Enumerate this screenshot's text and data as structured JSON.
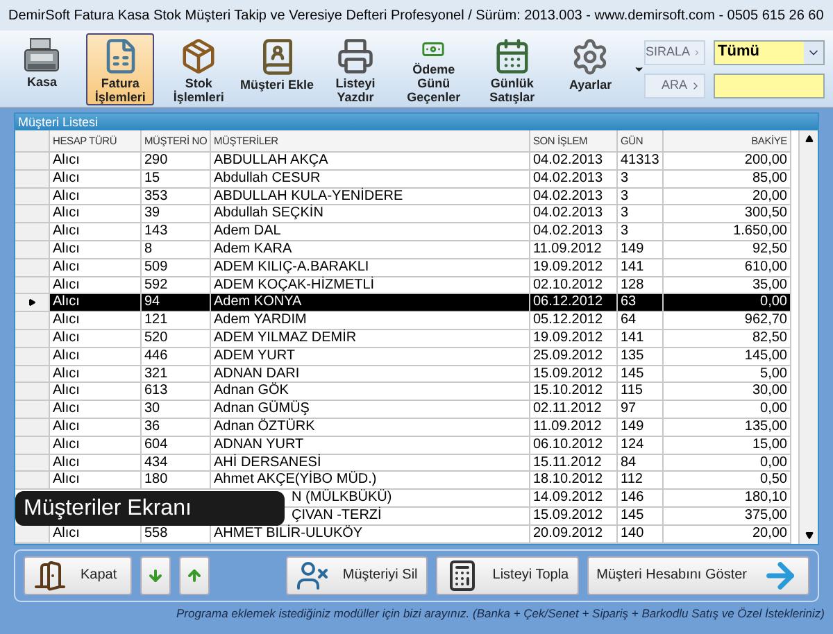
{
  "window": {
    "title": "DemirSoft Fatura Kasa Stok Müşteri Takip ve Veresiye Defteri Profesyonel  / Sürüm: 2013.003  -  www.demirsoft.com  -  0505 615 26 60"
  },
  "toolbar": {
    "items": [
      {
        "kind": "register",
        "label": "Kasa",
        "selected": false
      },
      {
        "kind": "invoice",
        "label": "Fatura İşlemleri",
        "selected": true
      },
      {
        "kind": "box",
        "label": "Stok İşlemleri",
        "selected": false
      },
      {
        "kind": "book",
        "label": "Müşteri Ekle",
        "selected": false
      },
      {
        "kind": "printer",
        "label": "Listeyi Yazdır",
        "selected": false
      },
      {
        "kind": "money",
        "label": "Ödeme Günü Geçenler",
        "selected": false
      },
      {
        "kind": "calendar",
        "label": "Günlük Satışlar",
        "selected": false
      },
      {
        "kind": "gear",
        "label": "Ayarlar",
        "selected": false
      }
    ]
  },
  "sort": {
    "label": "SIRALA",
    "value": "Tümü"
  },
  "search": {
    "label": "ARA"
  },
  "list": {
    "title": "Müşteri Listesi",
    "columns": [
      "HESAP TÜRÜ",
      "MÜŞTERİ NO",
      "MÜŞTERİLER",
      "SON İŞLEM",
      "GÜN",
      "BAKİYE"
    ],
    "rows": [
      {
        "type": "Alıcı",
        "no": "290",
        "name": "ABDULLAH AKÇA",
        "last": "04.02.2013",
        "days": "41313",
        "balance": "200,00",
        "selected": false
      },
      {
        "type": "Alıcı",
        "no": "15",
        "name": "Abdullah CESUR",
        "last": "04.02.2013",
        "days": "3",
        "balance": "85,00",
        "selected": false
      },
      {
        "type": "Alıcı",
        "no": "353",
        "name": "ABDULLAH KULA-YENİDERE",
        "last": "04.02.2013",
        "days": "3",
        "balance": "20,00",
        "selected": false
      },
      {
        "type": "Alıcı",
        "no": "39",
        "name": "Abdullah SEÇKİN",
        "last": "04.02.2013",
        "days": "3",
        "balance": "300,50",
        "selected": false
      },
      {
        "type": "Alıcı",
        "no": "143",
        "name": "Adem DAL",
        "last": "04.02.2013",
        "days": "3",
        "balance": "1.650,00",
        "selected": false
      },
      {
        "type": "Alıcı",
        "no": "8",
        "name": "Adem KARA",
        "last": "11.09.2012",
        "days": "149",
        "balance": "92,50",
        "selected": false
      },
      {
        "type": "Alıcı",
        "no": "509",
        "name": "ADEM KILIÇ-A.BARAKLI",
        "last": "19.09.2012",
        "days": "141",
        "balance": "610,00",
        "selected": false
      },
      {
        "type": "Alıcı",
        "no": "592",
        "name": "ADEM KOÇAK-HİZMETLİ",
        "last": "02.10.2012",
        "days": "128",
        "balance": "35,00",
        "selected": false
      },
      {
        "type": "Alıcı",
        "no": "94",
        "name": "Adem KONYA",
        "last": "06.12.2012",
        "days": "63",
        "balance": "0,00",
        "selected": true
      },
      {
        "type": "Alıcı",
        "no": "121",
        "name": "Adem YARDIM",
        "last": "05.12.2012",
        "days": "64",
        "balance": "962,70",
        "selected": false
      },
      {
        "type": "Alıcı",
        "no": "520",
        "name": "ADEM YILMAZ DEMİR",
        "last": "19.09.2012",
        "days": "141",
        "balance": "82,50",
        "selected": false
      },
      {
        "type": "Alıcı",
        "no": "446",
        "name": "ADEM YURT",
        "last": "25.09.2012",
        "days": "135",
        "balance": "145,00",
        "selected": false
      },
      {
        "type": "Alıcı",
        "no": "321",
        "name": "ADNAN DARI",
        "last": "15.09.2012",
        "days": "145",
        "balance": "5,00",
        "selected": false
      },
      {
        "type": "Alıcı",
        "no": "613",
        "name": "Adnan GÖK",
        "last": "15.10.2012",
        "days": "115",
        "balance": "30,00",
        "selected": false
      },
      {
        "type": "Alıcı",
        "no": "30",
        "name": "Adnan GÜMÜŞ",
        "last": "02.11.2012",
        "days": "97",
        "balance": "0,00",
        "selected": false
      },
      {
        "type": "Alıcı",
        "no": "36",
        "name": "Adnan ÖZTÜRK",
        "last": "11.09.2012",
        "days": "149",
        "balance": "135,00",
        "selected": false
      },
      {
        "type": "Alıcı",
        "no": "604",
        "name": "ADNAN YURT",
        "last": "06.10.2012",
        "days": "124",
        "balance": "15,00",
        "selected": false
      },
      {
        "type": "Alıcı",
        "no": "434",
        "name": "AHİ DERSANESİ",
        "last": "15.11.2012",
        "days": "84",
        "balance": "0,00",
        "selected": false
      },
      {
        "type": "Alıcı",
        "no": "180",
        "name": "Ahmet AKÇE(YİBO MÜD.)",
        "last": "18.10.2012",
        "days": "112",
        "balance": "0,50",
        "selected": false
      },
      {
        "name": "N (MÜLKBÜKÜ)",
        "last": "14.09.2012",
        "days": "146",
        "balance": "180,10",
        "selected": false
      },
      {
        "name": "ÇIVAN -TERZİ",
        "last": "15.09.2012",
        "days": "145",
        "balance": "375,00",
        "selected": false
      },
      {
        "type": "Alıcı",
        "no": "558",
        "name": "AHMET BİLİR-ULUKÖY",
        "last": "20.09.2012",
        "days": "140",
        "balance": "20,00",
        "selected": false
      }
    ]
  },
  "caption": "Müşteriler Ekranı",
  "buttons": [
    {
      "kind": "door",
      "label": "Kapat"
    },
    {
      "kind": "down"
    },
    {
      "kind": "up"
    },
    {
      "kind": "delete-user",
      "label": "Müşteriyi Sil"
    },
    {
      "kind": "calculator",
      "label": "Listeyi Topla"
    },
    {
      "kind": "arrow",
      "label": "Müşteri Hesabını Göster"
    }
  ],
  "footer_note": "Programa eklemek istediğiniz modüller için bizi arayınız. (Banka + Çek/Senet + Sipariş + Barkodlu Satış ve Özel İstekleriniz)"
}
